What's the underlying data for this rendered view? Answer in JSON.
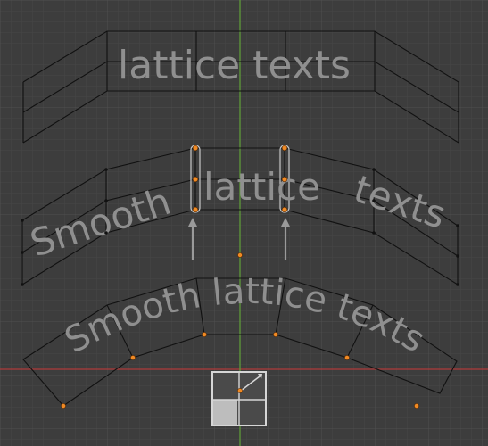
{
  "viewport": {
    "background_color": "#3d3d3d",
    "grid_minor_color": "#474747",
    "grid_major_color": "#505050",
    "axis_x_color": "#b03b3b",
    "axis_y_color": "#5f9a3a",
    "wire_color": "#111111",
    "text_color": "#8f8f8f",
    "vertex_selected_color": "#f08a24",
    "arrow_color": "#9a9a9a"
  },
  "texts": {
    "top": "lattice texts",
    "middle_left": "Smooth",
    "middle_center": "lattice",
    "middle_right": "texts",
    "bottom": "Smooth lattice texts"
  },
  "icons": {
    "upward_arrows": "up-arrow-icon",
    "lattice_gizmo": "lattice-gizmo-icon"
  }
}
